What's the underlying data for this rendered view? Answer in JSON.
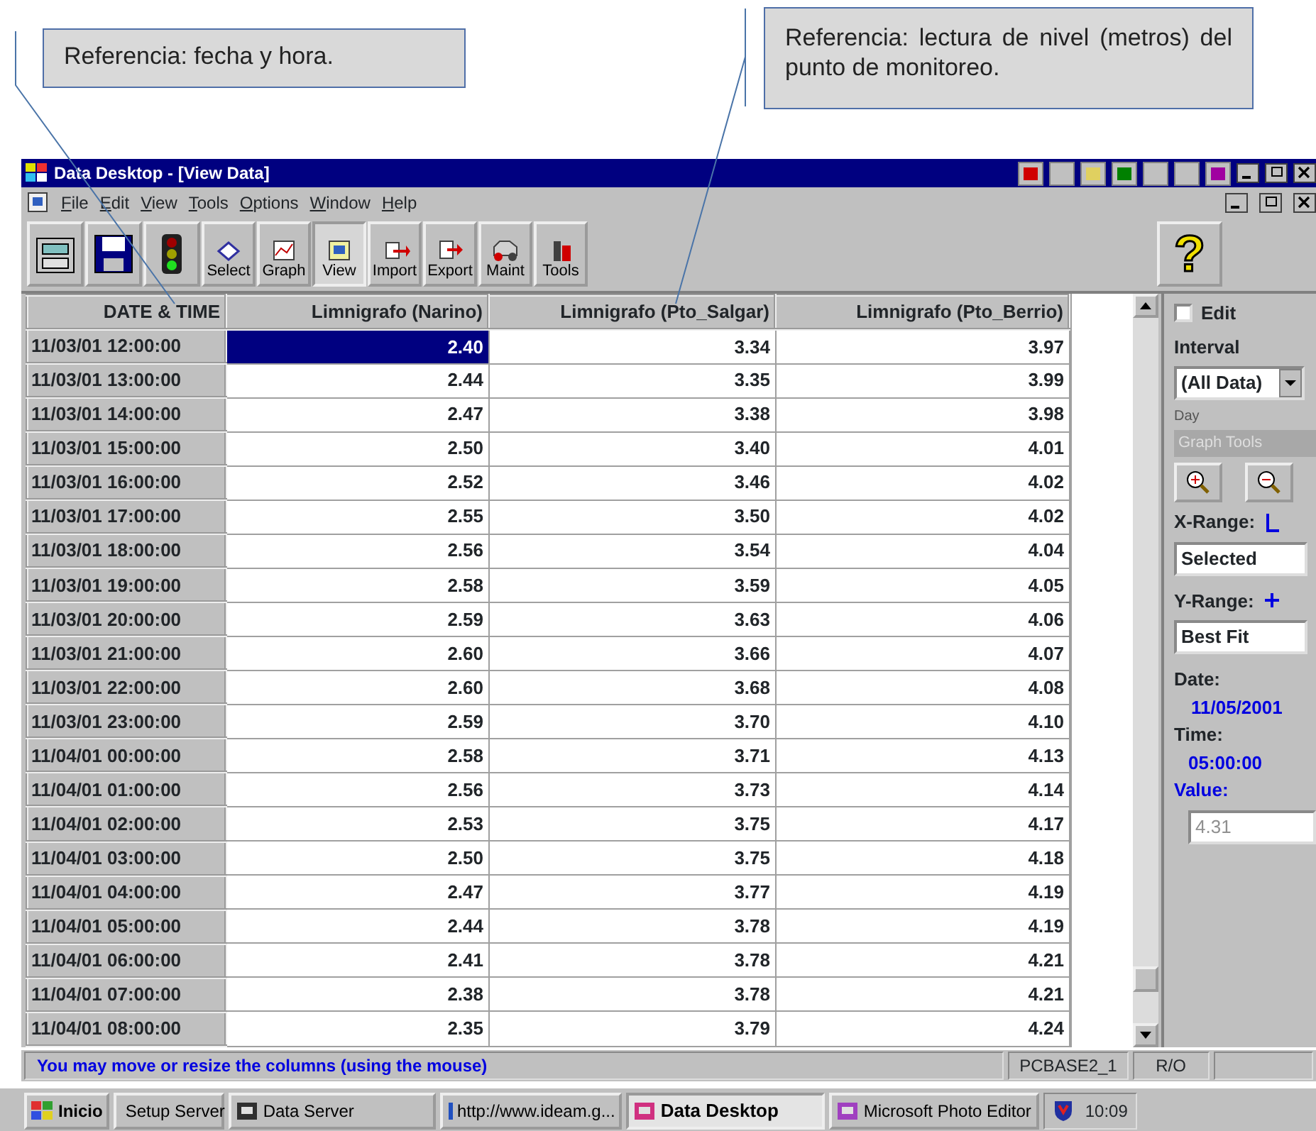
{
  "callouts": [
    {
      "text": "Referencia: fecha y hora."
    },
    {
      "text": "Referencia: lectura de nivel (metros) del punto de monitoreo."
    }
  ],
  "window": {
    "title": "Data Desktop - [View Data]"
  },
  "menu": [
    "File",
    "Edit",
    "View",
    "Tools",
    "Options",
    "Window",
    "Help"
  ],
  "toolbar": [
    {
      "kind": "icon"
    },
    {
      "kind": "icon"
    },
    {
      "kind": "icon"
    },
    {
      "kind": "labeled",
      "label": "Select",
      "pressed": false
    },
    {
      "kind": "labeled",
      "label": "Graph",
      "pressed": false
    },
    {
      "kind": "labeled",
      "label": "View",
      "pressed": true
    },
    {
      "kind": "labeled",
      "label": "Import",
      "pressed": false
    },
    {
      "kind": "labeled",
      "label": "Export",
      "pressed": false
    },
    {
      "kind": "labeled",
      "label": "Maint",
      "pressed": false
    },
    {
      "kind": "labeled",
      "label": "Tools",
      "pressed": false
    },
    {
      "kind": "help",
      "label": "?"
    }
  ],
  "table": {
    "columns": [
      "DATE & TIME",
      "Limnigrafo (Narino)",
      "Limnigrafo (Pto_Salgar)",
      "Limnigrafo (Pto_Berrio)"
    ],
    "rows": [
      {
        "cells": [
          {
            "text": "11/03/01 12:00:00",
            "selected": false
          },
          {
            "text": "2.40",
            "selected": true
          },
          {
            "text": "3.34",
            "selected": false
          },
          {
            "text": "3.97",
            "selected": false
          }
        ]
      },
      {
        "cells": [
          {
            "text": "11/03/01 13:00:00",
            "selected": false
          },
          {
            "text": "2.44",
            "selected": false
          },
          {
            "text": "3.35",
            "selected": false
          },
          {
            "text": "3.99",
            "selected": false
          }
        ]
      },
      {
        "cells": [
          {
            "text": "11/03/01 14:00:00",
            "selected": false
          },
          {
            "text": "2.47",
            "selected": false
          },
          {
            "text": "3.38",
            "selected": false
          },
          {
            "text": "3.98",
            "selected": false
          }
        ]
      },
      {
        "cells": [
          {
            "text": "11/03/01 15:00:00",
            "selected": false
          },
          {
            "text": "2.50",
            "selected": false
          },
          {
            "text": "3.40",
            "selected": false
          },
          {
            "text": "4.01",
            "selected": false
          }
        ]
      },
      {
        "cells": [
          {
            "text": "11/03/01 16:00:00",
            "selected": false
          },
          {
            "text": "2.52",
            "selected": false
          },
          {
            "text": "3.46",
            "selected": false
          },
          {
            "text": "4.02",
            "selected": false
          }
        ]
      },
      {
        "cells": [
          {
            "text": "11/03/01 17:00:00",
            "selected": false
          },
          {
            "text": "2.55",
            "selected": false
          },
          {
            "text": "3.50",
            "selected": false
          },
          {
            "text": "4.02",
            "selected": false
          }
        ]
      },
      {
        "cells": [
          {
            "text": "11/03/01 18:00:00",
            "selected": false
          },
          {
            "text": "2.56",
            "selected": false
          },
          {
            "text": "3.54",
            "selected": false
          },
          {
            "text": "4.04",
            "selected": false
          }
        ]
      },
      {
        "cells": [
          {
            "text": "11/03/01 19:00:00",
            "selected": false
          },
          {
            "text": "2.58",
            "selected": false
          },
          {
            "text": "3.59",
            "selected": false
          },
          {
            "text": "4.05",
            "selected": false
          }
        ]
      },
      {
        "cells": [
          {
            "text": "11/03/01 20:00:00",
            "selected": false
          },
          {
            "text": "2.59",
            "selected": false
          },
          {
            "text": "3.63",
            "selected": false
          },
          {
            "text": "4.06",
            "selected": false
          }
        ]
      },
      {
        "cells": [
          {
            "text": "11/03/01 21:00:00",
            "selected": false
          },
          {
            "text": "2.60",
            "selected": false
          },
          {
            "text": "3.66",
            "selected": false
          },
          {
            "text": "4.07",
            "selected": false
          }
        ]
      },
      {
        "cells": [
          {
            "text": "11/03/01 22:00:00",
            "selected": false
          },
          {
            "text": "2.60",
            "selected": false
          },
          {
            "text": "3.68",
            "selected": false
          },
          {
            "text": "4.08",
            "selected": false
          }
        ]
      },
      {
        "cells": [
          {
            "text": "11/03/01 23:00:00",
            "selected": false
          },
          {
            "text": "2.59",
            "selected": false
          },
          {
            "text": "3.70",
            "selected": false
          },
          {
            "text": "4.10",
            "selected": false
          }
        ]
      },
      {
        "cells": [
          {
            "text": "11/04/01 00:00:00",
            "selected": false
          },
          {
            "text": "2.58",
            "selected": false
          },
          {
            "text": "3.71",
            "selected": false
          },
          {
            "text": "4.13",
            "selected": false
          }
        ]
      },
      {
        "cells": [
          {
            "text": "11/04/01 01:00:00",
            "selected": false
          },
          {
            "text": "2.56",
            "selected": false
          },
          {
            "text": "3.73",
            "selected": false
          },
          {
            "text": "4.14",
            "selected": false
          }
        ]
      },
      {
        "cells": [
          {
            "text": "11/04/01 02:00:00",
            "selected": false
          },
          {
            "text": "2.53",
            "selected": false
          },
          {
            "text": "3.75",
            "selected": false
          },
          {
            "text": "4.17",
            "selected": false
          }
        ]
      },
      {
        "cells": [
          {
            "text": "11/04/01 03:00:00",
            "selected": false
          },
          {
            "text": "2.50",
            "selected": false
          },
          {
            "text": "3.75",
            "selected": false
          },
          {
            "text": "4.18",
            "selected": false
          }
        ]
      },
      {
        "cells": [
          {
            "text": "11/04/01 04:00:00",
            "selected": false
          },
          {
            "text": "2.47",
            "selected": false
          },
          {
            "text": "3.77",
            "selected": false
          },
          {
            "text": "4.19",
            "selected": false
          }
        ]
      },
      {
        "cells": [
          {
            "text": "11/04/01 05:00:00",
            "selected": false
          },
          {
            "text": "2.44",
            "selected": false
          },
          {
            "text": "3.78",
            "selected": false
          },
          {
            "text": "4.19",
            "selected": false
          }
        ]
      },
      {
        "cells": [
          {
            "text": "11/04/01 06:00:00",
            "selected": false
          },
          {
            "text": "2.41",
            "selected": false
          },
          {
            "text": "3.78",
            "selected": false
          },
          {
            "text": "4.21",
            "selected": false
          }
        ]
      },
      {
        "cells": [
          {
            "text": "11/04/01 07:00:00",
            "selected": false
          },
          {
            "text": "2.38",
            "selected": false
          },
          {
            "text": "3.78",
            "selected": false
          },
          {
            "text": "4.21",
            "selected": false
          }
        ]
      },
      {
        "cells": [
          {
            "text": "11/04/01 08:00:00",
            "selected": false
          },
          {
            "text": "2.35",
            "selected": false
          },
          {
            "text": "3.79",
            "selected": false
          },
          {
            "text": "4.24",
            "selected": false
          }
        ]
      }
    ]
  },
  "side_panel": {
    "edit": {
      "label": "Edit",
      "checked": false
    },
    "interval_label": "Interval",
    "interval": "(All Data)",
    "day_label": "Day",
    "graph_tools": "Graph Tools",
    "x_range_label": "X-Range:",
    "x_range": "Selected",
    "y_range_label": "Y-Range:",
    "y_range": "Best Fit",
    "date_label": "Date:",
    "date": "11/05/2001",
    "time_label": "Time:",
    "time": "05:00:00",
    "value_label": "Value:",
    "value": "4.31"
  },
  "status_bar": {
    "message": "You may move or resize the columns (using the mouse)",
    "panels": [
      "PCBASE2_1",
      "R/O"
    ]
  },
  "taskbar": {
    "start": "Inicio",
    "tasks": [
      {
        "label": "Setup Server",
        "selected": false
      },
      {
        "label": "Data Server",
        "selected": false
      },
      {
        "label": "http://www.ideam.g...",
        "selected": false
      },
      {
        "label": "Data Desktop",
        "selected": true
      },
      {
        "label": "Microsoft Photo Editor",
        "selected": false
      }
    ],
    "clock": "10:09"
  }
}
